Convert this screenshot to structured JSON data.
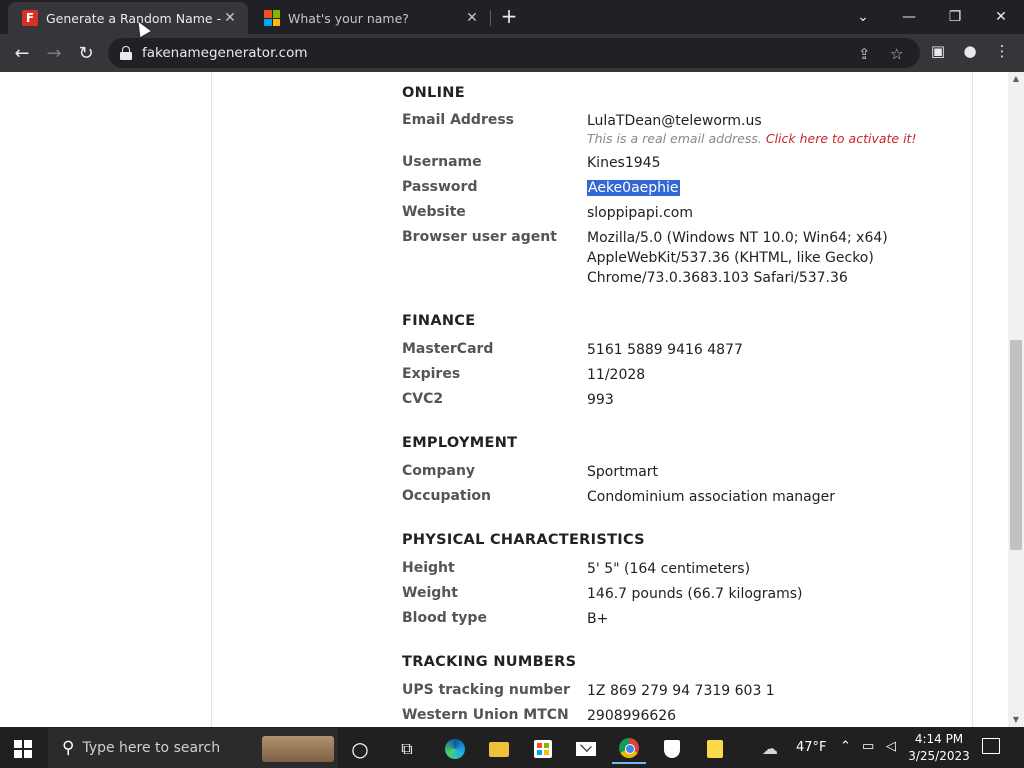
{
  "browser": {
    "tabs": [
      {
        "title": "Generate a Random Name - Fake",
        "active": true,
        "favicon": "F"
      },
      {
        "title": "What's your name?",
        "active": false,
        "favicon": "microsoft-logo"
      }
    ],
    "new_tab": "+",
    "url": "fakenamegenerator.com"
  },
  "sections": {
    "online": {
      "title": "ONLINE",
      "email_label": "Email Address",
      "email_value": "LulaTDean@teleworm.us",
      "email_note": "This is a real email address.",
      "email_note_link": "Click here to activate it!",
      "username_label": "Username",
      "username_value": "Kines1945",
      "password_label": "Password",
      "password_value": "Aeke0aephie",
      "website_label": "Website",
      "website_value": "sloppipapi.com",
      "ua_label": "Browser user agent",
      "ua_line1": "Mozilla/5.0 (Windows NT 10.0; Win64; x64)",
      "ua_line2": "AppleWebKit/537.36 (KHTML, like Gecko)",
      "ua_line3": "Chrome/73.0.3683.103 Safari/537.36"
    },
    "finance": {
      "title": "FINANCE",
      "card_label": "MasterCard",
      "card_value": "5161 5889 9416 4877",
      "expires_label": "Expires",
      "expires_value": "11/2028",
      "cvc_label": "CVC2",
      "cvc_value": "993"
    },
    "employment": {
      "title": "EMPLOYMENT",
      "company_label": "Company",
      "company_value": "Sportmart",
      "occupation_label": "Occupation",
      "occupation_value": "Condominium association manager"
    },
    "physical": {
      "title": "PHYSICAL CHARACTERISTICS",
      "height_label": "Height",
      "height_value": "5' 5\" (164 centimeters)",
      "weight_label": "Weight",
      "weight_value": "146.7 pounds (66.7 kilograms)",
      "blood_label": "Blood type",
      "blood_value": "B+"
    },
    "tracking": {
      "title": "TRACKING NUMBERS",
      "ups_label": "UPS tracking number",
      "ups_value": "1Z 869 279 94 7319 603 1",
      "wu_label": "Western Union MTCN",
      "wu_value": "2908996626"
    }
  },
  "taskbar": {
    "search_placeholder": "Type here to search",
    "weather": "47°F",
    "time": "4:14 PM",
    "date": "3/25/2023"
  },
  "colors": {
    "selection": "#3367d6",
    "link_red": "#c62828",
    "taskbar": "#202020",
    "browser_frame": "#202124"
  }
}
